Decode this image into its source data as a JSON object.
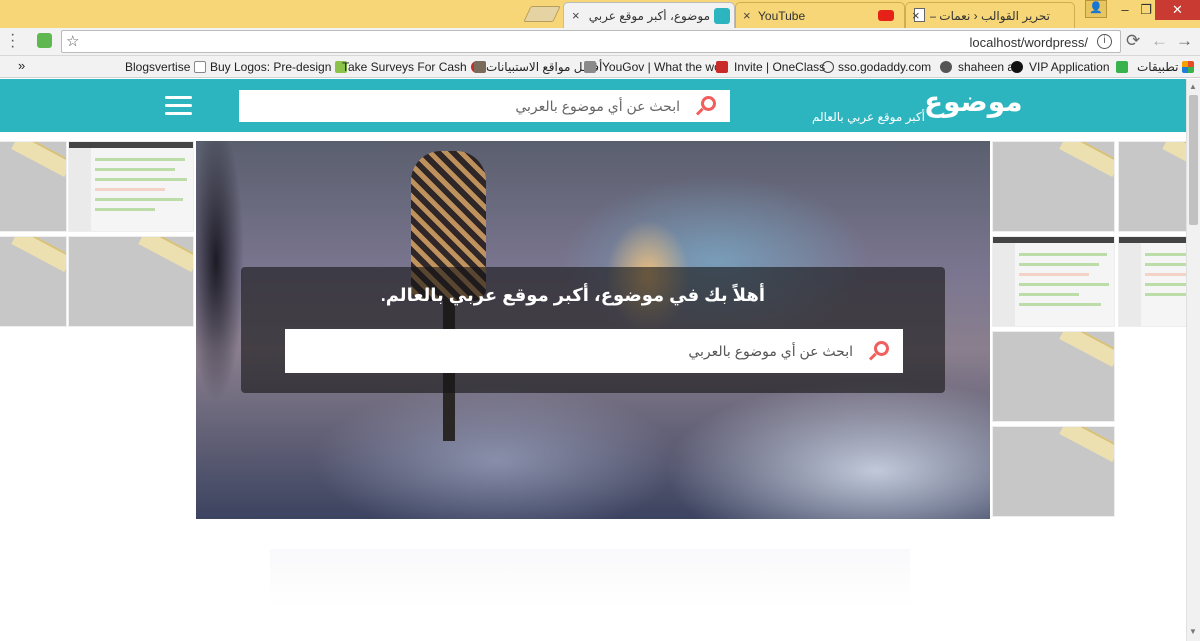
{
  "browser": {
    "tabs": [
      {
        "title": "",
        "active": false
      },
      {
        "title": "موضوع، أكبر موقع عربي بالعالم",
        "active": true
      },
      {
        "title": "YouTube",
        "active": false
      },
      {
        "title": "تحرير القوالب ‹ نعمات —",
        "active": false
      }
    ],
    "close_glyph": "×",
    "url": "localhost/wordpress/",
    "info_glyph": "i",
    "window_controls": {
      "minimize": "‒",
      "restore": "❐",
      "close": "✕"
    },
    "bookmarks_more": "»",
    "bookmarks": [
      {
        "label": "تطبيقات",
        "color": "#e44d26"
      },
      {
        "label": "VIP Application",
        "color": "#37b24d"
      },
      {
        "label": "shaheen a",
        "color": "#111111"
      },
      {
        "label": "sso.godaddy.com",
        "color": "#222222"
      },
      {
        "label": "Invite | OneClass",
        "color": "#444444"
      },
      {
        "label": "YouGov | What the wo",
        "color": "#c92a2a"
      },
      {
        "label": "أفضل مواقع الاستبيانات",
        "color": "#7a6a5a"
      },
      {
        "label": "Take Surveys For Cash",
        "color": "#c92a2a"
      },
      {
        "label": "Buy Logos: Pre-design",
        "color": "#8bc34a"
      },
      {
        "label": "Blogsvertise",
        "color": "#999999"
      }
    ]
  },
  "site": {
    "logo": "موضوع",
    "tagline": "أكبر موقع عربي بالعالم",
    "search_placeholder": "ابحث عن أي موضوع بالعربي",
    "hero_title": "أهلاً بك في موضوع، أكبر موقع عربي بالعالم.",
    "accent": "#2cb5bf",
    "search_icon_color": "#f15e5e"
  }
}
